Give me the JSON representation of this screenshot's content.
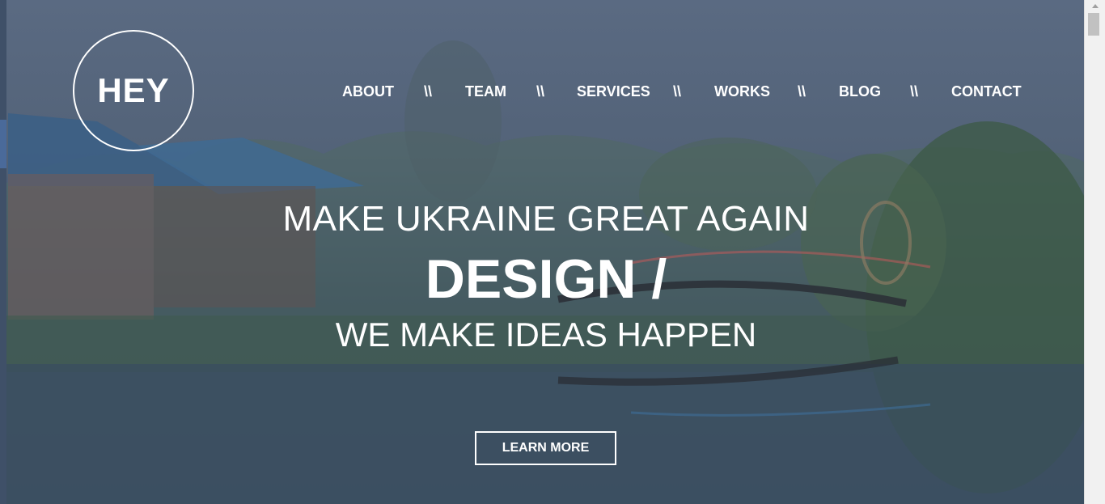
{
  "logo": {
    "text": "HEY"
  },
  "nav": {
    "items": [
      {
        "label": "ABOUT"
      },
      {
        "label": "TEAM"
      },
      {
        "label": "SERVICES"
      },
      {
        "label": "WORKS"
      },
      {
        "label": "BLOG"
      },
      {
        "label": "CONTACT"
      }
    ],
    "separator": "\\\\"
  },
  "hero": {
    "line1": "MAKE UKRAINE GREAT AGAIN",
    "line2": "DESIGN /",
    "line3": "WE MAKE IDEAS HAPPEN",
    "button_label": "LEARN MORE"
  },
  "colors": {
    "overlay": "#4a5a72",
    "text": "#ffffff"
  }
}
